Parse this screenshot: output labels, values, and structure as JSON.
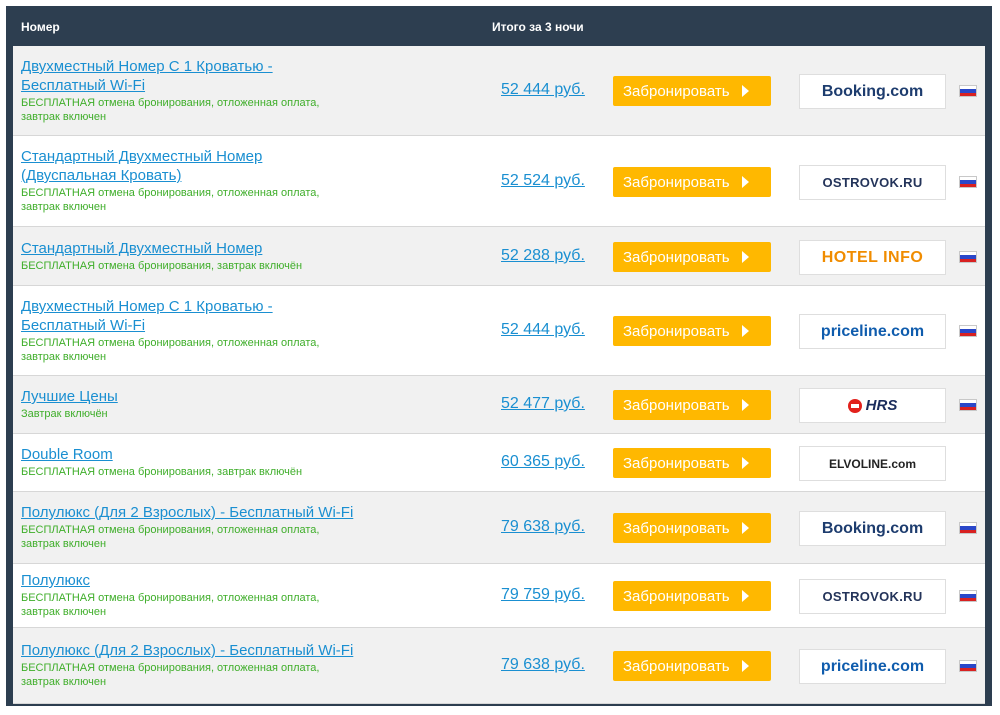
{
  "header": {
    "room_col": "Номер",
    "total_col": "Итого за 3 ночи"
  },
  "book_label": "Забронировать",
  "rows": [
    {
      "name_lines": [
        "Двухместный Номер С 1 Кроватью -",
        "Бесплатный Wi-Fi"
      ],
      "note_lines": [
        "БЕСПЛАТНАЯ отмена бронирования, отложенная оплата,",
        "завтрак включен"
      ],
      "price": "52 444 руб.",
      "partner": "Booking.com",
      "partner_icon": "booking-logo",
      "flag_icon": "russia-flag-icon"
    },
    {
      "name_lines": [
        "Стандартный Двухместный Номер",
        "(Двуспальная Кровать)"
      ],
      "note_lines": [
        "БЕСПЛАТНАЯ отмена бронирования, отложенная оплата,",
        "завтрак включен"
      ],
      "price": "52 524 руб.",
      "partner": "OSTROVOK.RU",
      "partner_icon": "ostrovok-logo",
      "flag_icon": "russia-flag-icon"
    },
    {
      "name_lines": [
        "Стандартный Двухместный Номер"
      ],
      "note_lines": [
        "БЕСПЛАТНАЯ отмена бронирования, завтрак включён"
      ],
      "price": "52 288 руб.",
      "partner": "HOTEL INFO",
      "partner_icon": "hotelinfo-logo",
      "flag_icon": "russia-flag-icon"
    },
    {
      "name_lines": [
        "Двухместный Номер С 1 Кроватью -",
        "Бесплатный Wi-Fi"
      ],
      "note_lines": [
        "БЕСПЛАТНАЯ отмена бронирования, отложенная оплата,",
        "завтрак включен"
      ],
      "price": "52 444 руб.",
      "partner": "priceline.com",
      "partner_icon": "priceline-logo",
      "flag_icon": "russia-flag-icon"
    },
    {
      "name_lines": [
        "Лучшие Цены"
      ],
      "note_lines": [
        "Завтрак включён"
      ],
      "price": "52 477 руб.",
      "partner": "HRS",
      "partner_icon": "hrs-logo",
      "flag_icon": "russia-flag-icon"
    },
    {
      "name_lines": [
        "Double Room"
      ],
      "note_lines": [
        "БЕСПЛАТНАЯ отмена бронирования, завтрак включён"
      ],
      "price": "60 365 руб.",
      "partner": "ELVOLINE.com",
      "partner_icon": "elvoline-logo",
      "flag_icon": ""
    },
    {
      "name_lines": [
        "Полулюкс (Для 2 Взрослых) - Бесплатный Wi-Fi"
      ],
      "note_lines": [
        "БЕСПЛАТНАЯ отмена бронирования, отложенная оплата,",
        "завтрак включен"
      ],
      "price": "79 638 руб.",
      "partner": "Booking.com",
      "partner_icon": "booking-logo",
      "flag_icon": "russia-flag-icon"
    },
    {
      "name_lines": [
        "Полулюкс"
      ],
      "note_lines": [
        "БЕСПЛАТНАЯ отмена бронирования, отложенная оплата,",
        "завтрак включен"
      ],
      "price": "79 759 руб.",
      "partner": "OSTROVOK.RU",
      "partner_icon": "ostrovok-logo",
      "flag_icon": "russia-flag-icon"
    },
    {
      "name_lines": [
        "Полулюкс (Для 2 Взрослых) - Бесплатный Wi-Fi"
      ],
      "note_lines": [
        "БЕСПЛАТНАЯ отмена бронирования, отложенная оплата,",
        "завтрак включен"
      ],
      "price": "79 638 руб.",
      "partner": "priceline.com",
      "partner_icon": "priceline-logo",
      "flag_icon": "russia-flag-icon"
    }
  ],
  "colors": {
    "header_bg": "#2d3e50",
    "link": "#1a8fd1",
    "note": "#3fae2a",
    "button": "#ffb800"
  }
}
